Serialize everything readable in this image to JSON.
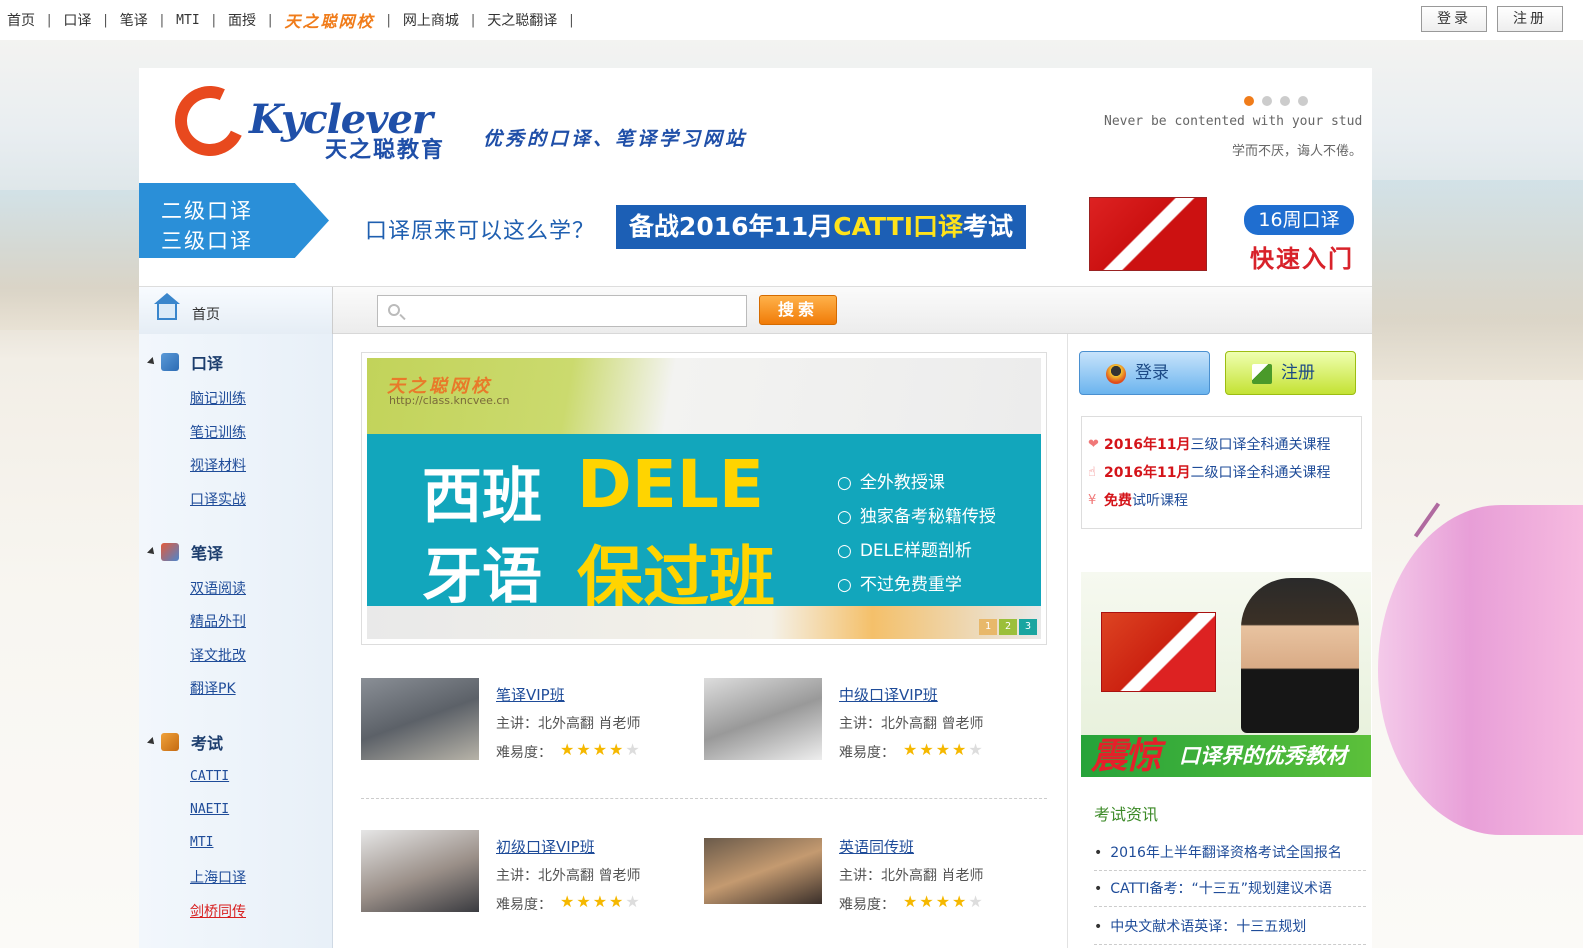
{
  "topnav": {
    "items": [
      "首页",
      "口译",
      "笔译",
      "MTI",
      "面授",
      "天之聪网校",
      "网上商城",
      "天之聪翻译"
    ],
    "separator": "|",
    "login": "登录",
    "register": "注册"
  },
  "header": {
    "logo_text": "Kyclever",
    "logo_cn": "天之聪教育",
    "slogan": "优秀的口译、笔译学习网站",
    "quote_en": "Never be contented with your stud",
    "quote_cn": "学而不厌，诲人不倦。"
  },
  "banner": {
    "level_line1": "二级口译",
    "level_line2": "三级口译",
    "question": "口译原来可以这么学？",
    "catti_prefix": "备战2016年11月",
    "catti_highlight": "CATTI口译",
    "catti_suffix": "考试",
    "weeks_badge": "16周口译",
    "weeks_sub": "快速入门"
  },
  "nav": {
    "home": "首页",
    "search_placeholder": "",
    "search_button": "搜索"
  },
  "sidebar": {
    "categories": [
      {
        "label": "口译",
        "items": [
          "脑记训练",
          "笔记训练",
          "视译材料",
          "口译实战"
        ]
      },
      {
        "label": "笔译",
        "items": [
          "双语阅读",
          "精品外刊",
          "译文批改",
          "翻译PK"
        ]
      },
      {
        "label": "考试",
        "items": [
          "CATTI",
          "NAETI",
          "MTI",
          "上海口译",
          "剑桥同传"
        ]
      }
    ]
  },
  "slider": {
    "watermark": "天之聪网校",
    "url": "http://class.kncvee.cn",
    "title_a1": "西班",
    "title_a2": "牙语",
    "title_b1": "DELE",
    "title_b2": "保过班",
    "points": [
      "全外教授课",
      "独家备考秘籍传授",
      "DELE样题剖析",
      "不过免费重学"
    ],
    "pager": [
      "1",
      "2",
      "3"
    ]
  },
  "courses": [
    {
      "title": "笔译VIP班",
      "teacher": "主讲：北外高翻 肖老师",
      "difficulty_label": "难易度：",
      "rating": 4,
      "max_rating": 5
    },
    {
      "title": "中级口译VIP班",
      "teacher": "主讲：北外高翻 曾老师",
      "difficulty_label": "难易度：",
      "rating": 4,
      "max_rating": 5
    },
    {
      "title": "初级口译VIP班",
      "teacher": "主讲：北外高翻 曾老师",
      "difficulty_label": "难易度：",
      "rating": 4,
      "max_rating": 5
    },
    {
      "title": "英语同传班",
      "teacher": "主讲：北外高翻 肖老师",
      "difficulty_label": "难易度：",
      "rating": 4,
      "max_rating": 5
    }
  ],
  "right": {
    "login": "登录",
    "register": "注册",
    "promo": [
      {
        "red": "2016年11月",
        "text": "三级口译全科通关课程"
      },
      {
        "red": "2016年11月",
        "text": "二级口译全科通关课程"
      },
      {
        "red": "免费",
        "text": "试听课程"
      }
    ],
    "ad_shock": "震惊",
    "ad_band": "口译界的优秀教材",
    "news_title": "考试资讯",
    "news": [
      "2016年上半年翻译资格考试全国报名",
      "CATTI备考：“十三五”规划建议术语",
      "中央文献术语英译：十三五规划"
    ]
  },
  "colors": {
    "accent": "#f07c1a",
    "link": "#1f4c99",
    "brand_blue": "#1f4fa8",
    "highlight_red": "#d4141a"
  }
}
